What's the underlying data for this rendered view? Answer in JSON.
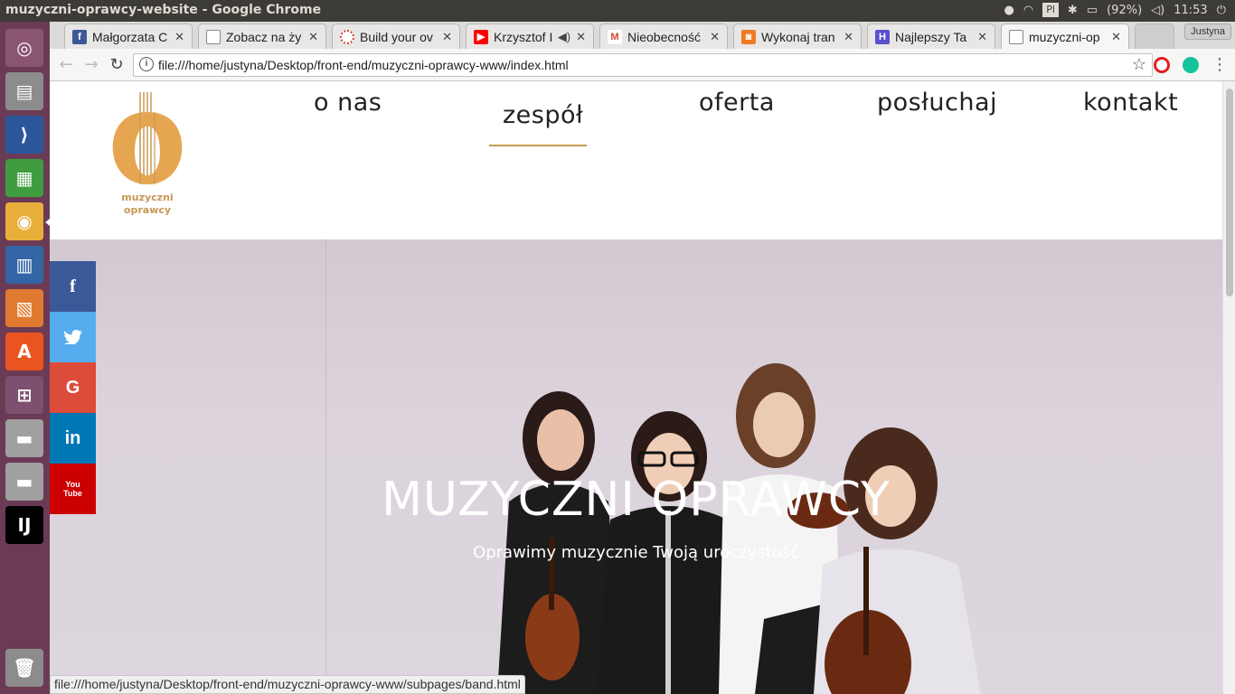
{
  "os": {
    "window_title": "muzyczni-oprawcy-website - Google Chrome",
    "keyboard_layout": "Pl",
    "battery": "(92%)",
    "clock": "11:53"
  },
  "browser": {
    "user_chip": "Justyna",
    "tabs": [
      {
        "label": "Małgorzata C",
        "icon": "facebook-icon",
        "color": "#3b5998"
      },
      {
        "label": "Zobacz na ży",
        "icon": "page-icon",
        "color": "#888888"
      },
      {
        "label": "Build your ov",
        "icon": "build-icon",
        "color": "#d33a2c"
      },
      {
        "label": "Krzysztof I",
        "icon": "youtube-icon",
        "color": "#ff0000"
      },
      {
        "label": "Nieobecność",
        "icon": "gmail-icon",
        "color": "#d44638"
      },
      {
        "label": "Wykonaj tran",
        "icon": "wykonaj-icon",
        "color": "#f07a22"
      },
      {
        "label": "Najlepszy Ta",
        "icon": "najlepszy-icon",
        "color": "#5a4fcf"
      },
      {
        "label": "muzyczni-op",
        "icon": "page-icon",
        "color": "#888888"
      }
    ],
    "url": "file:///home/justyna/Desktop/front-end/muzyczni-oprawcy-www/index.html",
    "status_url": "file:///home/justyna/Desktop/front-end/muzyczni-oprawcy-www/subpages/band.html"
  },
  "site": {
    "logo_text_line1": "muzyczni",
    "logo_text_line2": "oprawcy",
    "accent": "#c59a55",
    "nav": [
      "o nas",
      "zespół",
      "oferta",
      "posłuchaj",
      "kontakt"
    ],
    "hero_title": "MUZYCZNI OPRAWCY",
    "hero_subtitle": "Oprawimy muzycznie Twoją uroczystość"
  },
  "social": [
    {
      "name": "facebook",
      "glyph": "f",
      "color": "#3b5998"
    },
    {
      "name": "twitter",
      "glyph": "t",
      "color": "#55acee"
    },
    {
      "name": "google",
      "glyph": "G",
      "color": "#dd4b39"
    },
    {
      "name": "linkedin",
      "glyph": "in",
      "color": "#0077b5"
    },
    {
      "name": "youtube",
      "glyph": "You Tube",
      "color": "#cc0000"
    }
  ]
}
